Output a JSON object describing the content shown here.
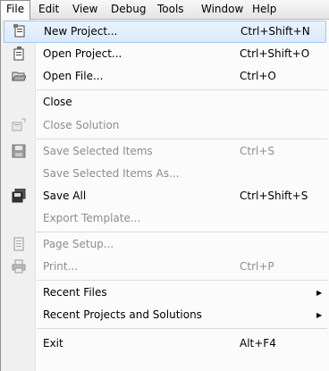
{
  "menubar": {
    "items": [
      {
        "label": "File"
      },
      {
        "label": "Edit"
      },
      {
        "label": "View"
      },
      {
        "label": "Debug"
      },
      {
        "label": "Tools"
      },
      {
        "label": "Window"
      },
      {
        "label": "Help"
      }
    ]
  },
  "file_menu": {
    "items": [
      {
        "label": "New Project...",
        "shortcut": "Ctrl+Shift+N",
        "icon": "new-project-icon",
        "enabled": true,
        "highlighted": true
      },
      {
        "label": "Open Project...",
        "shortcut": "Ctrl+Shift+O",
        "icon": "open-project-icon",
        "enabled": true
      },
      {
        "label": "Open File...",
        "shortcut": "Ctrl+O",
        "icon": "open-folder-icon",
        "enabled": true
      },
      {
        "label": "Close",
        "shortcut": "",
        "enabled": true
      },
      {
        "label": "Close Solution",
        "shortcut": "",
        "icon": "close-solution-icon",
        "enabled": false
      },
      {
        "label": "Save Selected Items",
        "shortcut": "Ctrl+S",
        "icon": "save-icon",
        "enabled": false
      },
      {
        "label": "Save Selected Items As...",
        "shortcut": "",
        "enabled": false
      },
      {
        "label": "Save All",
        "shortcut": "Ctrl+Shift+S",
        "icon": "save-all-icon",
        "enabled": true
      },
      {
        "label": "Export Template...",
        "shortcut": "",
        "enabled": false
      },
      {
        "label": "Page Setup...",
        "shortcut": "",
        "icon": "page-setup-icon",
        "enabled": false
      },
      {
        "label": "Print...",
        "shortcut": "Ctrl+P",
        "icon": "printer-icon",
        "enabled": false
      },
      {
        "label": "Recent Files",
        "submenu": true,
        "enabled": true
      },
      {
        "label": "Recent Projects and Solutions",
        "submenu": true,
        "enabled": true
      },
      {
        "label": "Exit",
        "shortcut": "Alt+F4",
        "enabled": true
      }
    ]
  },
  "colors": {
    "highlight": "#dbe9fb",
    "disabled_text": "#8d8d8d"
  }
}
